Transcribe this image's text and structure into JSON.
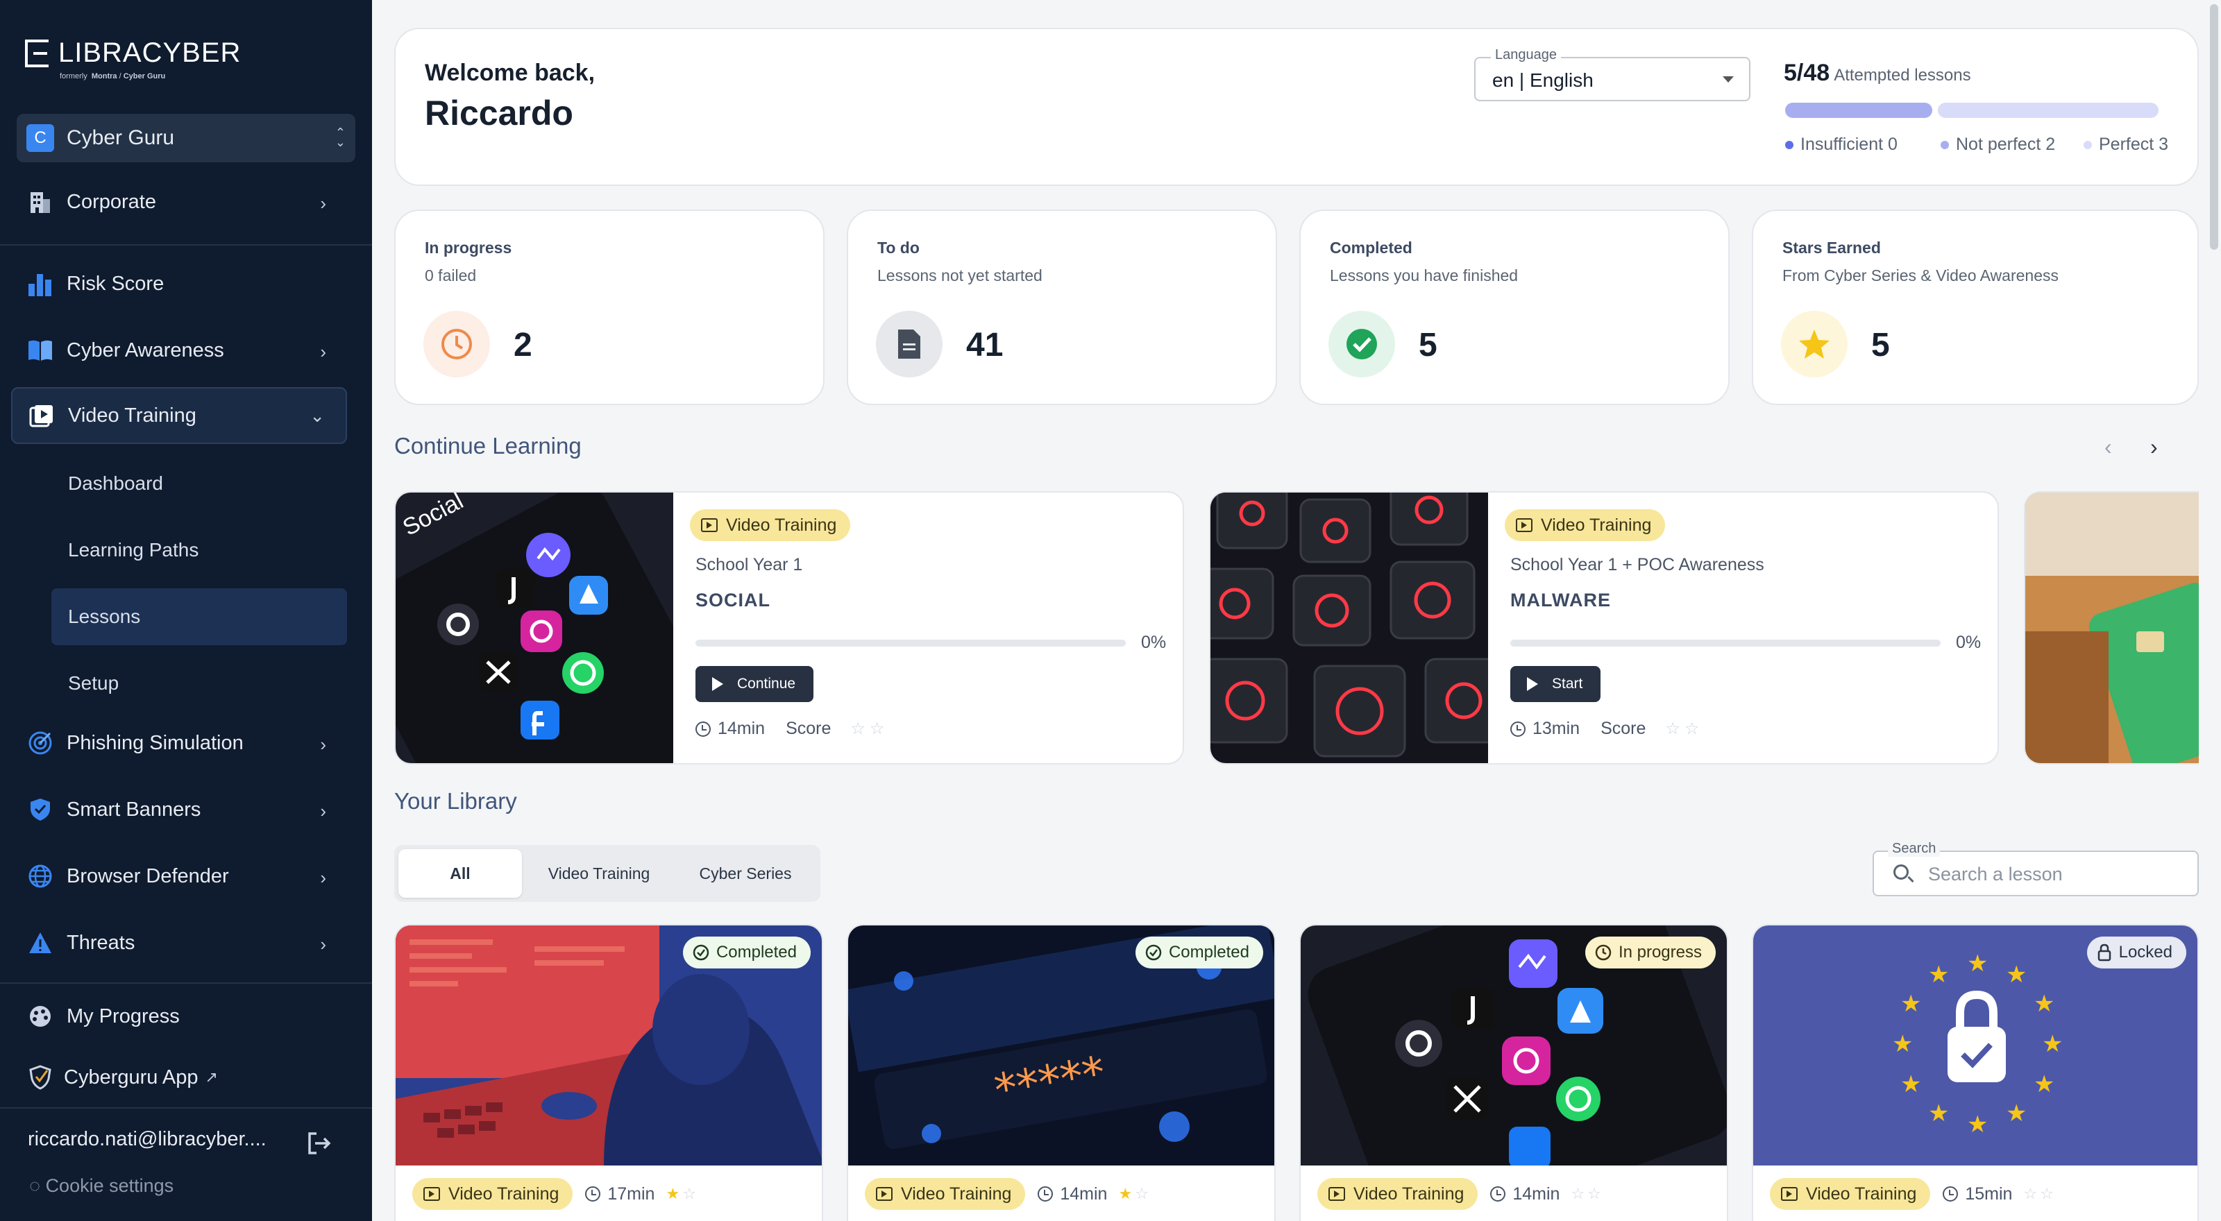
{
  "brand": {
    "name": "LIBRACYBER",
    "formerly": "formerly",
    "formerly_brand_a": "Montra",
    "formerly_sep": "/",
    "formerly_brand_b": "Cyber Guru"
  },
  "org": {
    "badge": "C",
    "name": "Cyber Guru"
  },
  "nav": {
    "corporate": "Corporate",
    "risk_score": "Risk Score",
    "cyber_awareness": "Cyber Awareness",
    "video_training": "Video Training",
    "sub": {
      "dashboard": "Dashboard",
      "learning_paths": "Learning Paths",
      "lessons": "Lessons",
      "setup": "Setup"
    },
    "phishing": "Phishing Simulation",
    "smart_banners": "Smart Banners",
    "browser_defender": "Browser Defender",
    "threats": "Threats",
    "my_progress": "My Progress",
    "cyberguru_app": "Cyberguru App"
  },
  "user": {
    "email": "riccardo.nati@libracyber....",
    "cookie": "Cookie settings"
  },
  "header": {
    "greeting": "Welcome back,",
    "name": "Riccardo",
    "language_label": "Language",
    "language_value": "en | English",
    "attempted_count": "5/48",
    "attempted_label": "Attempted lessons",
    "legend": [
      {
        "label": "Insufficient 0",
        "color": "#5b6ee8"
      },
      {
        "label": "Not perfect 2",
        "color": "#a7aef0"
      },
      {
        "label": "Perfect 3",
        "color": "#d9dcf8"
      }
    ]
  },
  "stats": [
    {
      "title": "In progress",
      "subtitle": "0 failed",
      "value": "2",
      "icon": "clock-icon"
    },
    {
      "title": "To do",
      "subtitle": "Lessons not yet started",
      "value": "41",
      "icon": "document-icon"
    },
    {
      "title": "Completed",
      "subtitle": "Lessons you have finished",
      "value": "5",
      "icon": "check-circle-icon"
    },
    {
      "title": "Stars Earned",
      "subtitle": "From Cyber Series & Video Awareness",
      "value": "5",
      "icon": "star-icon"
    }
  ],
  "continue_learning": {
    "title": "Continue Learning",
    "cards": [
      {
        "badge": "Video Training",
        "school": "School Year 1",
        "name": "SOCIAL",
        "progress": "0%",
        "button": "Continue",
        "duration": "14min",
        "score_label": "Score"
      },
      {
        "badge": "Video Training",
        "school": "School Year 1 + POC Awareness",
        "name": "MALWARE",
        "progress": "0%",
        "button": "Start",
        "duration": "13min",
        "score_label": "Score"
      }
    ]
  },
  "library": {
    "title": "Your Library",
    "tabs": [
      "All",
      "Video Training",
      "Cyber Series"
    ],
    "search_label": "Search",
    "search_placeholder": "Search a lesson",
    "cards": [
      {
        "status": "Completed",
        "badge": "Video Training",
        "duration": "17min",
        "stars": 1
      },
      {
        "status": "Completed",
        "badge": "Video Training",
        "duration": "14min",
        "stars": 1
      },
      {
        "status": "In progress",
        "badge": "Video Training",
        "duration": "14min",
        "stars": 0
      },
      {
        "status": "Locked",
        "badge": "Video Training",
        "duration": "15min",
        "stars": 0
      }
    ]
  }
}
